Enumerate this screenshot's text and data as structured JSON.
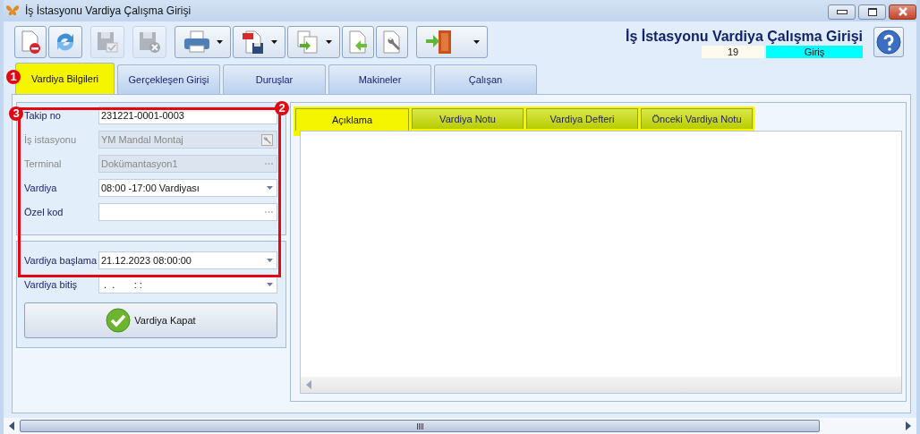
{
  "window": {
    "title": "İş İstasyonu Vardiya Çalışma Girişi"
  },
  "toolbar": [
    [
      {
        "kind": "delete-doc",
        "disabled": false,
        "dropdown": false
      },
      {
        "kind": "refresh",
        "disabled": false,
        "dropdown": false
      }
    ],
    [
      {
        "kind": "save-check",
        "disabled": true,
        "dropdown": false
      }
    ],
    [
      {
        "kind": "save-cancel",
        "disabled": true,
        "dropdown": false
      }
    ],
    [
      {
        "kind": "print",
        "disabled": false,
        "dropdown": true
      },
      {
        "kind": "pdf-save",
        "disabled": false,
        "dropdown": true
      },
      {
        "kind": "copy-doc",
        "disabled": false,
        "dropdown": true
      },
      {
        "kind": "doc-arrow",
        "disabled": false,
        "dropdown": false
      },
      {
        "kind": "doc-wrench",
        "disabled": false,
        "dropdown": false
      }
    ],
    [
      {
        "kind": "door",
        "disabled": false,
        "dropdown": true
      }
    ]
  ],
  "header": {
    "title": "İş İstasyonu Vardiya Çalışma Girişi",
    "number": "19",
    "mode": "Giriş"
  },
  "tabs": [
    {
      "label": "Vardiya Bilgileri",
      "selected": true
    },
    {
      "label": "Gerçekleşen Girişi",
      "selected": false
    },
    {
      "label": "Duruşlar",
      "selected": false
    },
    {
      "label": "Makineler",
      "selected": false
    },
    {
      "label": "Çalışan",
      "selected": false
    }
  ],
  "form": [
    {
      "label": "Takip no",
      "value": "231221-0001-0003",
      "kind": "text",
      "disabled": false
    },
    {
      "label": "İş istasyonu",
      "value": "YM Mandal Montaj",
      "kind": "lookup",
      "disabled": true
    },
    {
      "label": "Terminal",
      "value": "Dokümantasyon1",
      "kind": "ellipsis",
      "disabled": true
    },
    {
      "label": "Vardiya",
      "value": "08:00 -17:00 Vardiyası",
      "kind": "dropdown",
      "disabled": false
    },
    {
      "label": "Özel kod",
      "kind": "ellipsis",
      "disabled": false
    }
  ],
  "schedule": [
    {
      "label": "Vardiya başlama",
      "value": "21.12.2023 08:00:00"
    },
    {
      "label": "Vardiya bitiş",
      "value": " .  .       : :"
    }
  ],
  "close_button": {
    "label": "Vardiya Kapat"
  },
  "detail_tabs": [
    {
      "label": "Açıklama",
      "selected": true
    },
    {
      "label": "Vardiya Notu",
      "selected": false
    },
    {
      "label": "Vardiya Defteri",
      "selected": false
    },
    {
      "label": "Önceki Vardiya Notu",
      "selected": false
    }
  ],
  "annotations": [
    {
      "label": "1"
    },
    {
      "label": "2"
    },
    {
      "label": "3"
    }
  ]
}
